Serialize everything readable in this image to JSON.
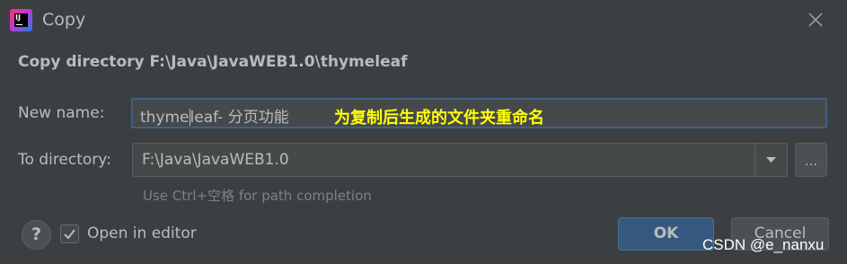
{
  "window": {
    "title": "Copy",
    "app_icon": "intellij-idea-icon",
    "app_icon_text": "IJ",
    "close_icon": "close-icon"
  },
  "header": {
    "text": "Copy directory F:\\Java\\JavaWEB1.0\\thymeleaf"
  },
  "new_name": {
    "label": "New name:",
    "value_before_caret": "thyme",
    "value_after_caret": "leaf- 分页功能"
  },
  "annotation": {
    "text": "为复制后生成的文件夹重命名",
    "color": "#ffff00"
  },
  "to_directory": {
    "label": "To directory:",
    "value": "F:\\Java\\JavaWEB1.0",
    "dropdown_icon": "chevron-down-icon",
    "browse_label": "...",
    "hint": "Use Ctrl+空格 for path completion"
  },
  "footer": {
    "help_label": "?",
    "open_in_editor_label": "Open in editor",
    "open_in_editor_checked": true,
    "ok_label": "OK",
    "cancel_label": "Cancel"
  },
  "watermark": {
    "text": "CSDN @e_nanxu"
  },
  "colors": {
    "background": "#3c3f41",
    "input_background": "#45494a",
    "focus_border": "#3d6185",
    "primary_button": "#365880",
    "text": "#bbbbbb",
    "hint_text": "#808080"
  }
}
